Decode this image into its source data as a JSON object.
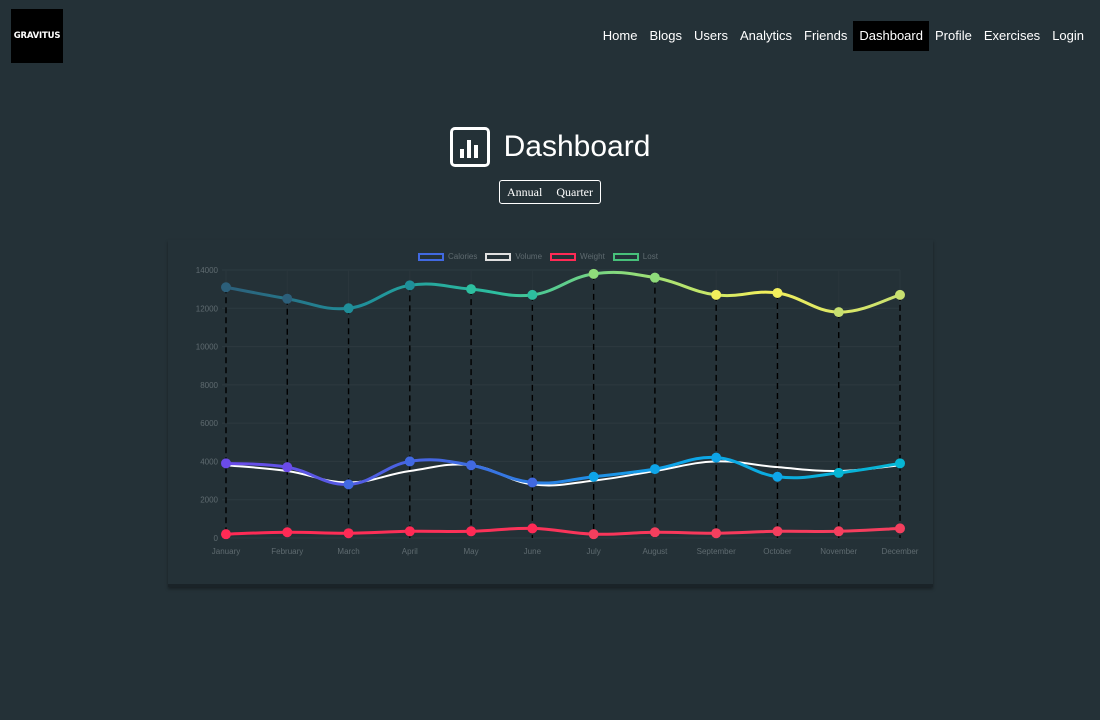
{
  "logo": {
    "text": "GRAVITUS"
  },
  "nav": {
    "items": [
      {
        "label": "Home",
        "active": false
      },
      {
        "label": "Blogs",
        "active": false
      },
      {
        "label": "Users",
        "active": false
      },
      {
        "label": "Analytics",
        "active": false
      },
      {
        "label": "Friends",
        "active": false
      },
      {
        "label": "Dashboard",
        "active": true
      },
      {
        "label": "Profile",
        "active": false
      },
      {
        "label": "Exercises",
        "active": false
      },
      {
        "label": "Login",
        "active": false
      }
    ]
  },
  "page": {
    "title": "Dashboard",
    "icon": "bar-chart-icon"
  },
  "period_toggle": {
    "annual": "Annual",
    "quarter": "Quarter"
  },
  "chart_data": {
    "type": "line",
    "categories": [
      "January",
      "February",
      "March",
      "April",
      "May",
      "June",
      "July",
      "August",
      "September",
      "October",
      "November",
      "December"
    ],
    "ylim": [
      0,
      14000
    ],
    "yticks": [
      0,
      2000,
      4000,
      6000,
      8000,
      10000,
      12000,
      14000
    ],
    "grid": true,
    "legend_position": "top",
    "series": [
      {
        "name": "Calories",
        "color": "#4169e1",
        "values": [
          3900,
          3700,
          2800,
          4000,
          3800,
          2900,
          3200,
          3600,
          4200,
          3200,
          3400,
          3900
        ]
      },
      {
        "name": "Volume",
        "color": "#e0e0e0",
        "values": [
          3800,
          3500,
          2900,
          3500,
          3800,
          2800,
          3000,
          3500,
          4000,
          3700,
          3500,
          3800
        ]
      },
      {
        "name": "Weight",
        "color": "#ff2a55",
        "values": [
          200,
          300,
          250,
          350,
          350,
          500,
          200,
          300,
          250,
          350,
          350,
          500
        ]
      },
      {
        "name": "Lost",
        "color": "#47c07a",
        "values": [
          13100,
          12500,
          12000,
          13200,
          13000,
          12700,
          13800,
          13600,
          12700,
          12800,
          11800,
          12700
        ]
      }
    ],
    "gradients": {
      "Calories": [
        "#6b4be8",
        "#4169e1",
        "#0ea5e9",
        "#06b6d4"
      ],
      "Volume": [
        "#ffffff",
        "#ffffff"
      ],
      "Weight": [
        "#ff2a55",
        "#f43f5e"
      ],
      "Lost": [
        "#2c5f7a",
        "#1f8f9a",
        "#2dbfa0",
        "#8fdc7a",
        "#f2ef5c",
        "#c8e070"
      ]
    }
  }
}
